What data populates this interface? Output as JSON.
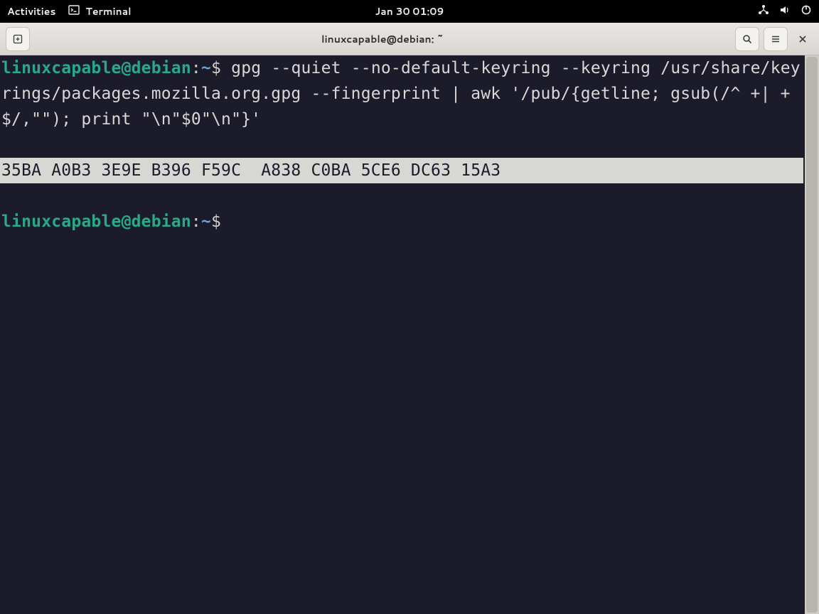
{
  "topbar": {
    "activities": "Activities",
    "app_name": "Terminal",
    "clock": "Jan 30  01:09"
  },
  "window": {
    "title": "linuxcapable@debian: ~"
  },
  "terminal": {
    "prompt": {
      "user_host": "linuxcapable@debian",
      "colon": ":",
      "path": "~",
      "symbol": "$"
    },
    "command": "gpg --quiet --no-default-keyring --keyring /usr/share/keyrings/packages.mozilla.org.gpg --fingerprint | awk '/pub/{getline; gsub(/^ +| +$/,\"\"); print \"\\n\"$0\"\\n\"}'",
    "output_fingerprint": "35BA A0B3 3E9E B396 F59C  A838 C0BA 5CE6 DC63 15A3"
  }
}
